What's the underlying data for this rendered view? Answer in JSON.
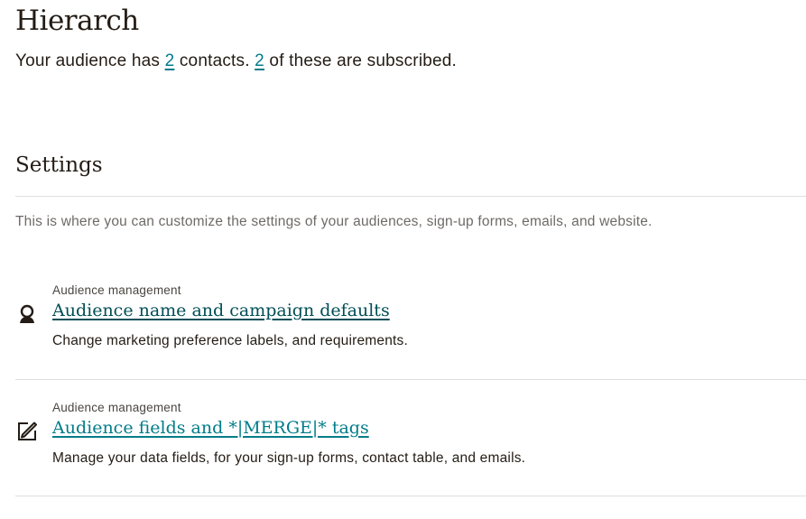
{
  "header": {
    "title": "Hierarch",
    "summary_prefix": "Your audience has ",
    "contacts_count": "2",
    "summary_middle": " contacts. ",
    "subscribed_count": "2",
    "summary_suffix": " of these are subscribed."
  },
  "settings": {
    "title": "Settings",
    "description": "This is where you can customize the settings of your audiences, sign-up forms, emails, and website.",
    "items": [
      {
        "eyebrow": "Audience management",
        "icon": "person-icon",
        "link_label": "Audience name and campaign defaults",
        "description": "Change marketing preference labels, and requirements."
      },
      {
        "eyebrow": "Audience management",
        "icon": "edit-square-icon",
        "link_label": "Audience fields and *|MERGE|* tags",
        "description": "Manage your data fields, for your sign-up forms, contact table, and emails."
      }
    ]
  },
  "colors": {
    "text": "#241c15",
    "link_teal": "#007c89",
    "link_dark": "#004e56",
    "muted": "#6e6a66",
    "divider": "#e0dfdc"
  }
}
